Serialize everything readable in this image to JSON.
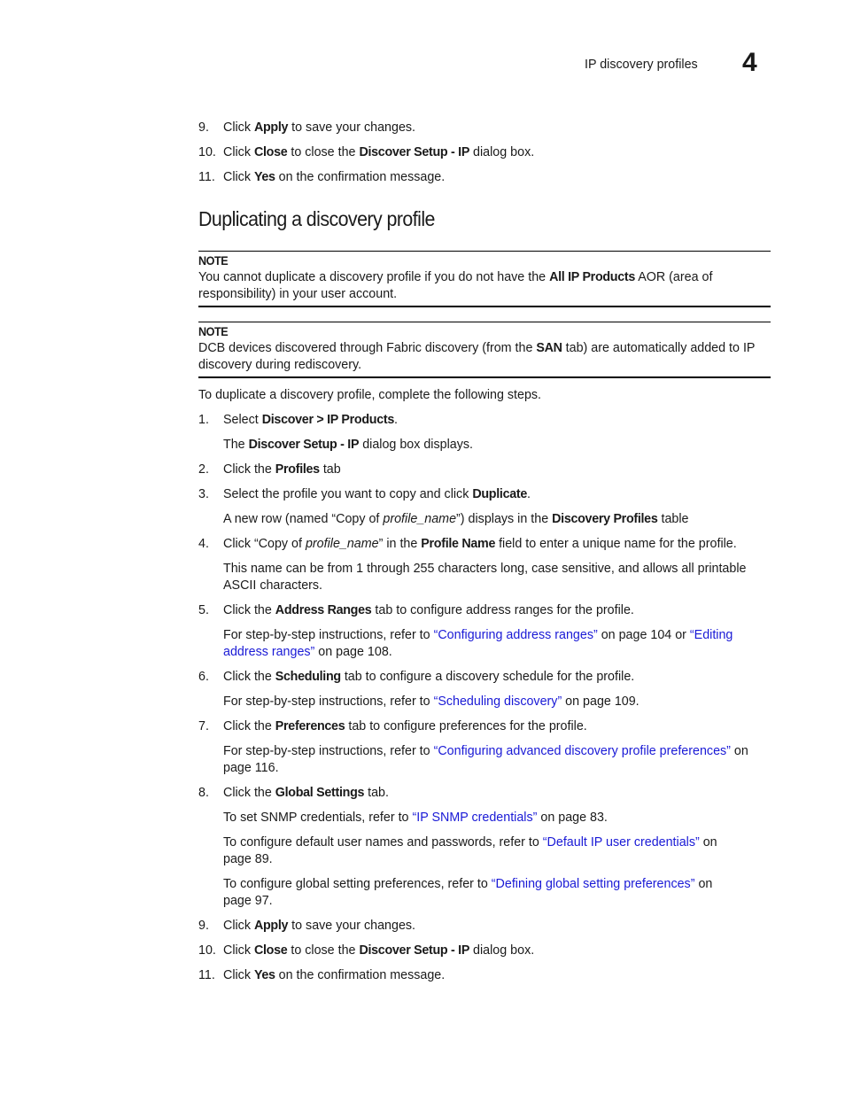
{
  "header": {
    "section_title": "IP discovery profiles",
    "chapter_number": "4"
  },
  "previous_steps": [
    {
      "num": "9.",
      "parts": [
        [
          "t",
          "Click "
        ],
        [
          "b",
          "Apply"
        ],
        [
          "t",
          " to save your changes."
        ]
      ]
    },
    {
      "num": "10.",
      "parts": [
        [
          "t",
          "Click "
        ],
        [
          "b",
          "Close"
        ],
        [
          "t",
          " to close the "
        ],
        [
          "b",
          "Discover Setup - IP"
        ],
        [
          "t",
          " dialog box."
        ]
      ]
    },
    {
      "num": "11.",
      "parts": [
        [
          "t",
          "Click "
        ],
        [
          "b",
          "Yes"
        ],
        [
          "t",
          " on the confirmation message."
        ]
      ]
    }
  ],
  "section": {
    "title": "Duplicating a discovery profile",
    "notes": [
      {
        "label": "NOTE",
        "lines": [
          [
            [
              "t",
              "You cannot duplicate a discovery profile if you do not have the "
            ],
            [
              "b",
              "All IP Products"
            ],
            [
              "t",
              " AOR (area of"
            ]
          ],
          [
            [
              "t",
              "responsibility) in your user account."
            ]
          ]
        ]
      },
      {
        "label": "NOTE",
        "lines": [
          [
            [
              "t",
              "DCB devices discovered through Fabric discovery (from the "
            ],
            [
              "b",
              "SAN"
            ],
            [
              "t",
              " tab) are automatically added to IP"
            ]
          ],
          [
            [
              "t",
              "discovery during rediscovery."
            ]
          ]
        ]
      }
    ],
    "intro": "To duplicate a discovery profile, complete the following steps.",
    "steps": [
      {
        "num": "1.",
        "parts": [
          [
            "t",
            "Select "
          ],
          [
            "b",
            "Discover > IP Products"
          ],
          [
            "t",
            "."
          ]
        ],
        "sub": [
          [
            [
              [
                "t",
                "The "
              ],
              [
                "b",
                "Discover Setup - IP"
              ],
              [
                "t",
                " dialog box displays."
              ]
            ]
          ]
        ]
      },
      {
        "num": "2.",
        "parts": [
          [
            "t",
            "Click the "
          ],
          [
            "b",
            "Profiles"
          ],
          [
            "t",
            " tab"
          ]
        ],
        "sub": []
      },
      {
        "num": "3.",
        "parts": [
          [
            "t",
            "Select the profile you want to copy and click "
          ],
          [
            "b",
            "Duplicate"
          ],
          [
            "t",
            "."
          ]
        ],
        "sub": [
          [
            [
              [
                "t",
                "A new row (named “Copy of "
              ],
              [
                "i",
                "profile_name"
              ],
              [
                "t",
                "”) displays in the "
              ],
              [
                "b",
                "Discovery Profiles"
              ],
              [
                "t",
                " table"
              ]
            ]
          ]
        ]
      },
      {
        "num": "4.",
        "parts": [
          [
            "t",
            "Click “Copy of "
          ],
          [
            "i",
            "profile_name"
          ],
          [
            "t",
            "” in the "
          ],
          [
            "b",
            "Profile Name"
          ],
          [
            "t",
            " field to enter a unique name for the profile."
          ]
        ],
        "sub": [
          [
            [
              [
                "t",
                "This name can be from 1 through 255 characters long, case sensitive, and allows all printable"
              ]
            ],
            [
              [
                "t",
                "ASCII characters."
              ]
            ]
          ]
        ]
      },
      {
        "num": "5.",
        "parts": [
          [
            "t",
            "Click the "
          ],
          [
            "b",
            "Address Ranges"
          ],
          [
            "t",
            " tab to configure address ranges for the profile."
          ]
        ],
        "sub": [
          [
            [
              [
                "t",
                "For step-by-step instructions, refer to "
              ],
              [
                "a",
                "“Configuring address ranges”"
              ],
              [
                "t",
                " on page 104 or "
              ],
              [
                "a",
                "“Editing"
              ]
            ],
            [
              [
                "a",
                "address ranges”"
              ],
              [
                "t",
                " on page 108."
              ]
            ]
          ]
        ]
      },
      {
        "num": "6.",
        "parts": [
          [
            "t",
            "Click the "
          ],
          [
            "b",
            "Scheduling"
          ],
          [
            "t",
            " tab to configure a discovery schedule for the profile."
          ]
        ],
        "sub": [
          [
            [
              [
                "t",
                "For step-by-step instructions, refer to "
              ],
              [
                "a",
                "“Scheduling discovery”"
              ],
              [
                "t",
                " on page 109."
              ]
            ]
          ]
        ]
      },
      {
        "num": "7.",
        "parts": [
          [
            "t",
            "Click the "
          ],
          [
            "b",
            "Preferences"
          ],
          [
            "t",
            " tab to configure preferences for the profile."
          ]
        ],
        "sub": [
          [
            [
              [
                "t",
                "For step-by-step instructions, refer to "
              ],
              [
                "a",
                "“Configuring advanced discovery profile preferences”"
              ],
              [
                "t",
                " on"
              ]
            ],
            [
              [
                "t",
                "page 116."
              ]
            ]
          ]
        ]
      },
      {
        "num": "8.",
        "parts": [
          [
            "t",
            "Click the "
          ],
          [
            "b",
            "Global Settings"
          ],
          [
            "t",
            " tab."
          ]
        ],
        "sub": [
          [
            [
              [
                "t",
                "To set SNMP credentials, refer to "
              ],
              [
                "a",
                "“IP SNMP credentials”"
              ],
              [
                "t",
                " on page 83."
              ]
            ]
          ],
          [
            [
              [
                "t",
                "To configure default user names and passwords, refer to "
              ],
              [
                "a",
                "“Default IP user credentials”"
              ],
              [
                "t",
                " on"
              ]
            ],
            [
              [
                "t",
                "page 89."
              ]
            ]
          ],
          [
            [
              [
                "t",
                "To configure global setting preferences, refer to "
              ],
              [
                "a",
                "“Defining global setting preferences”"
              ],
              [
                "t",
                " on"
              ]
            ],
            [
              [
                "t",
                "page 97."
              ]
            ]
          ]
        ]
      },
      {
        "num": "9.",
        "parts": [
          [
            "t",
            "Click "
          ],
          [
            "b",
            "Apply"
          ],
          [
            "t",
            " to save your changes."
          ]
        ],
        "sub": []
      },
      {
        "num": "10.",
        "parts": [
          [
            "t",
            "Click "
          ],
          [
            "b",
            "Close"
          ],
          [
            "t",
            " to close the "
          ],
          [
            "b",
            "Discover Setup - IP"
          ],
          [
            "t",
            " dialog box."
          ]
        ],
        "sub": []
      },
      {
        "num": "11.",
        "parts": [
          [
            "t",
            "Click "
          ],
          [
            "b",
            "Yes"
          ],
          [
            "t",
            " on the confirmation message."
          ]
        ],
        "sub": []
      }
    ]
  },
  "link_color": "#1a1ad6"
}
